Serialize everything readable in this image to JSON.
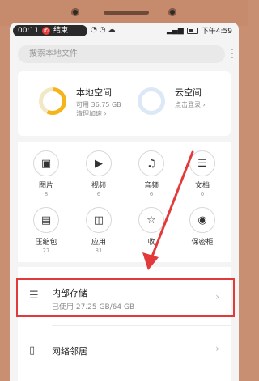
{
  "status_bar": {
    "time_left": "00:11",
    "call_text": "结束",
    "time_right": "下午4:59",
    "icons": [
      "hangup-icon",
      "wifi-icon",
      "alarm-icon",
      "cloud-icon",
      "signal-icon",
      "battery-icon"
    ]
  },
  "search": {
    "placeholder": "搜索本地文件"
  },
  "storage": {
    "local": {
      "title": "本地空间",
      "sub1": "可用 36.75 GB",
      "sub2": "清理加速 ›",
      "used_fraction": 0.57
    },
    "cloud": {
      "title": "云空间",
      "sub1": "点击登录 ›"
    }
  },
  "categories": [
    {
      "name": "图片",
      "count": "8",
      "icon": "image-icon"
    },
    {
      "name": "视频",
      "count": "6",
      "icon": "video-icon"
    },
    {
      "name": "音频",
      "count": "6",
      "icon": "music-icon"
    },
    {
      "name": "文档",
      "count": "0",
      "icon": "document-icon"
    },
    {
      "name": "压缩包",
      "count": "27",
      "icon": "zip-icon"
    },
    {
      "name": "应用",
      "count": "81",
      "icon": "bag-icon"
    },
    {
      "name": "收",
      "count": "",
      "icon": "star-icon"
    },
    {
      "name": "保密柜",
      "count": "",
      "icon": "safe-icon"
    }
  ],
  "list": {
    "internal": {
      "title": "内部存储",
      "sub": "已使用 27.25 GB/64 GB"
    },
    "network": {
      "title": "网络邻居"
    }
  },
  "colors": {
    "highlight": "#e23a3a",
    "ring_local": "#f4b41a",
    "ring_cloud": "#dde8f6"
  }
}
